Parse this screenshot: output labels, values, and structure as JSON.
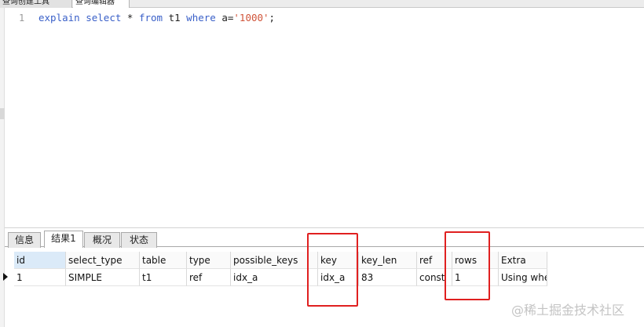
{
  "top_tabs": [
    "查询创建工具",
    "查询编辑器"
  ],
  "editor": {
    "line_number": "1",
    "code_tokens": [
      {
        "text": "explain",
        "kind": "kw"
      },
      {
        "text": " ",
        "kind": "plain"
      },
      {
        "text": "select",
        "kind": "kw"
      },
      {
        "text": " * ",
        "kind": "plain"
      },
      {
        "text": "from",
        "kind": "kw"
      },
      {
        "text": " t1 ",
        "kind": "plain"
      },
      {
        "text": "where",
        "kind": "kw"
      },
      {
        "text": " a=",
        "kind": "plain"
      },
      {
        "text": "'1000'",
        "kind": "str"
      },
      {
        "text": ";",
        "kind": "plain"
      }
    ]
  },
  "result_tabs": [
    {
      "label": "信息",
      "active": false
    },
    {
      "label": "结果1",
      "active": true
    },
    {
      "label": "概况",
      "active": false
    },
    {
      "label": "状态",
      "active": false
    }
  ],
  "table": {
    "columns": [
      "id",
      "select_type",
      "table",
      "type",
      "possible_keys",
      "key",
      "key_len",
      "ref",
      "rows",
      "Extra"
    ],
    "rows": [
      [
        "1",
        "SIMPLE",
        "t1",
        "ref",
        "idx_a",
        "idx_a",
        "83",
        "const",
        "1",
        "Using whe"
      ]
    ]
  },
  "watermark": "@稀土掘金技术社区",
  "colors": {
    "keyword": "#3a60c8",
    "string": "#d0543a",
    "annotation": "#e02020"
  }
}
